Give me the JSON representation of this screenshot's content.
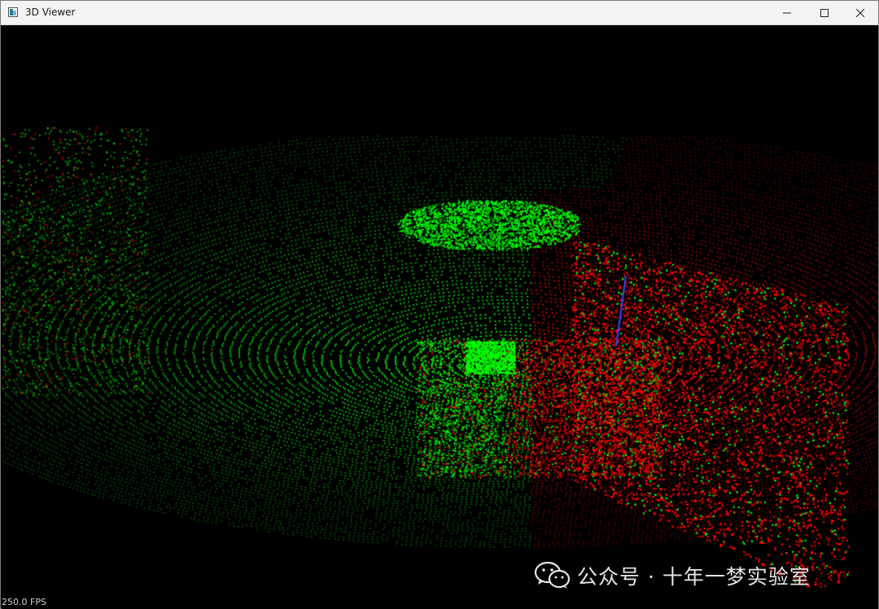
{
  "window": {
    "title": "3D Viewer",
    "controls": {
      "minimize": "minimize",
      "maximize": "maximize",
      "close": "close"
    }
  },
  "viewport": {
    "fps": "250.0 FPS",
    "background": "#000000",
    "point_colors": [
      "#00ff00",
      "#ff0000"
    ],
    "axis_color": "#3344ff"
  },
  "watermark": {
    "icon": "wechat-icon",
    "text": "公众号 · 十年一梦实验室"
  }
}
